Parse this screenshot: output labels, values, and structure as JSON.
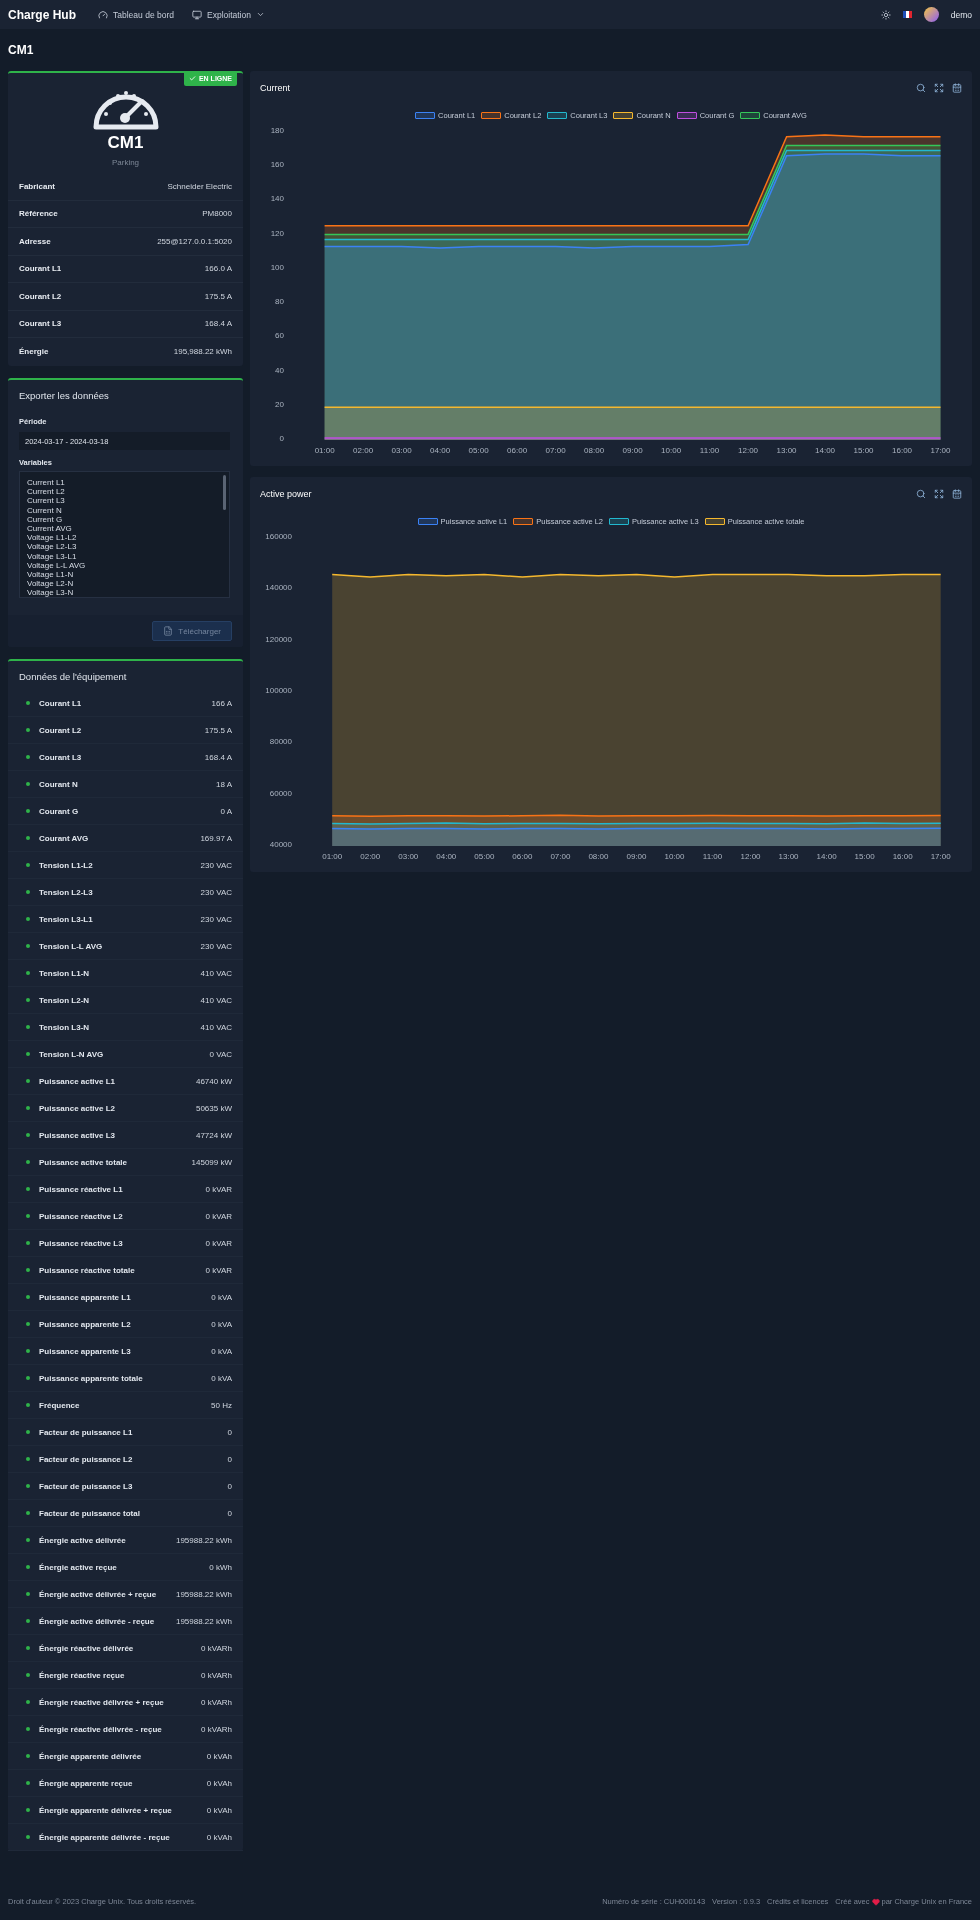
{
  "header": {
    "brand": "Charge Hub",
    "nav": [
      {
        "label": "Tableau de bord",
        "kind": "link"
      },
      {
        "label": "Exploitation",
        "kind": "dropdown"
      }
    ],
    "user": "demo"
  },
  "page_title": "CM1",
  "device": {
    "status": "EN LIGNE",
    "online": true,
    "name": "CM1",
    "location": "Parking",
    "properties": [
      {
        "label": "Fabricant",
        "value": "Schneider Electric"
      },
      {
        "label": "Référence",
        "value": "PM8000"
      },
      {
        "label": "Adresse",
        "value": "255@127.0.0.1:5020"
      },
      {
        "label": "Courant L1",
        "value": "166.0 A"
      },
      {
        "label": "Courant L2",
        "value": "175.5 A"
      },
      {
        "label": "Courant L3",
        "value": "168.4 A"
      },
      {
        "label": "Énergie",
        "value": "195,988.22 kWh"
      }
    ]
  },
  "export": {
    "title": "Exporter les données",
    "period_label": "Période",
    "period": "2024-03-17 - 2024-03-18",
    "variables_label": "Variables",
    "variables": [
      "Current L1",
      "Current L2",
      "Current L3",
      "Current N",
      "Current G",
      "Current AVG",
      "Voltage L1-L2",
      "Voltage L2-L3",
      "Voltage L3-L1",
      "Voltage L-L AVG",
      "Voltage L1-N",
      "Voltage L2-N",
      "Voltage L3-N"
    ],
    "download": "Télécharger",
    "download_disabled": true
  },
  "equipment": {
    "title": "Données de l'équipement",
    "rows": [
      {
        "label": "Courant L1",
        "value": "166 A"
      },
      {
        "label": "Courant L2",
        "value": "175.5 A"
      },
      {
        "label": "Courant L3",
        "value": "168.4 A"
      },
      {
        "label": "Courant N",
        "value": "18 A"
      },
      {
        "label": "Courant G",
        "value": "0 A"
      },
      {
        "label": "Courant AVG",
        "value": "169.97 A"
      },
      {
        "label": "Tension L1-L2",
        "value": "230 VAC"
      },
      {
        "label": "Tension L2-L3",
        "value": "230 VAC"
      },
      {
        "label": "Tension L3-L1",
        "value": "230 VAC"
      },
      {
        "label": "Tension L-L AVG",
        "value": "230 VAC"
      },
      {
        "label": "Tension L1-N",
        "value": "410 VAC"
      },
      {
        "label": "Tension L2-N",
        "value": "410 VAC"
      },
      {
        "label": "Tension L3-N",
        "value": "410 VAC"
      },
      {
        "label": "Tension L-N AVG",
        "value": "0 VAC"
      },
      {
        "label": "Puissance active L1",
        "value": "46740 kW"
      },
      {
        "label": "Puissance active L2",
        "value": "50635 kW"
      },
      {
        "label": "Puissance active L3",
        "value": "47724 kW"
      },
      {
        "label": "Puissance active totale",
        "value": "145099 kW"
      },
      {
        "label": "Puissance réactive L1",
        "value": "0 kVAR"
      },
      {
        "label": "Puissance réactive L2",
        "value": "0 kVAR"
      },
      {
        "label": "Puissance réactive L3",
        "value": "0 kVAR"
      },
      {
        "label": "Puissance réactive totale",
        "value": "0 kVAR"
      },
      {
        "label": "Puissance apparente L1",
        "value": "0 kVA"
      },
      {
        "label": "Puissance apparente L2",
        "value": "0 kVA"
      },
      {
        "label": "Puissance apparente L3",
        "value": "0 kVA"
      },
      {
        "label": "Puissance apparente totale",
        "value": "0 kVA"
      },
      {
        "label": "Fréquence",
        "value": "50 Hz"
      },
      {
        "label": "Facteur de puissance L1",
        "value": "0"
      },
      {
        "label": "Facteur de puissance L2",
        "value": "0"
      },
      {
        "label": "Facteur de puissance L3",
        "value": "0"
      },
      {
        "label": "Facteur de puissance total",
        "value": "0"
      },
      {
        "label": "Énergie active délivrée",
        "value": "195988.22 kWh"
      },
      {
        "label": "Énergie active reçue",
        "value": "0 kWh"
      },
      {
        "label": "Énergie active délivrée + reçue",
        "value": "195988.22 kWh"
      },
      {
        "label": "Énergie active délivrée - reçue",
        "value": "195988.22 kWh"
      },
      {
        "label": "Énergie réactive délivrée",
        "value": "0 kVARh"
      },
      {
        "label": "Énergie réactive reçue",
        "value": "0 kVARh"
      },
      {
        "label": "Énergie réactive délivrée + reçue",
        "value": "0 kVARh"
      },
      {
        "label": "Énergie réactive délivrée - reçue",
        "value": "0 kVARh"
      },
      {
        "label": "Énergie apparente délivrée",
        "value": "0 kVAh"
      },
      {
        "label": "Énergie apparente reçue",
        "value": "0 kVAh"
      },
      {
        "label": "Énergie apparente délivrée + reçue",
        "value": "0 kVAh"
      },
      {
        "label": "Énergie apparente délivrée - reçue",
        "value": "0 kVAh"
      }
    ]
  },
  "charts": [
    {
      "title": "Current",
      "chart_data": {
        "type": "area",
        "legend": "top",
        "categories": [
          "01:00",
          "02:00",
          "03:00",
          "04:00",
          "05:00",
          "06:00",
          "07:00",
          "08:00",
          "09:00",
          "10:00",
          "11:00",
          "12:00",
          "13:00",
          "14:00",
          "15:00",
          "16:00",
          "17:00"
        ],
        "ylim": [
          0,
          180
        ],
        "yticks": [
          0,
          20,
          40,
          60,
          80,
          100,
          120,
          140,
          160,
          180
        ],
        "series": [
          {
            "name": "Courant L1",
            "color": "#3b82f6",
            "values": [
              112,
              112,
              112,
              111,
              112,
              112,
              112,
              111,
              112,
              112,
              112,
              113,
              165,
              166,
              166,
              165,
              165
            ]
          },
          {
            "name": "Courant L2",
            "color": "#f97316",
            "values": [
              124,
              124,
              124,
              124,
              124,
              124,
              124,
              124,
              124,
              124,
              124,
              124,
              176,
              177,
              176,
              176,
              176
            ]
          },
          {
            "name": "Courant L3",
            "color": "#22b8cf",
            "values": [
              116,
              116,
              116,
              116,
              116,
              116,
              116,
              116,
              116,
              116,
              116,
              116,
              168,
              168,
              168,
              168,
              168
            ]
          },
          {
            "name": "Courant N",
            "color": "#f5b82e",
            "values": [
              18,
              18,
              18,
              18,
              18,
              18,
              18,
              18,
              18,
              18,
              18,
              18,
              18,
              18,
              18,
              18,
              18
            ]
          },
          {
            "name": "Courant G",
            "color": "#c04ee0",
            "values": [
              0,
              0,
              0,
              0,
              0,
              0,
              0,
              0,
              0,
              0,
              0,
              0,
              0,
              0,
              0,
              0,
              0
            ]
          },
          {
            "name": "Courant AVG",
            "color": "#34c759",
            "values": [
              119,
              119,
              119,
              119,
              119,
              119,
              119,
              119,
              119,
              119,
              119,
              119,
              171,
              171,
              171,
              171,
              171
            ]
          }
        ]
      }
    },
    {
      "title": "Active power",
      "chart_data": {
        "type": "area",
        "legend": "top",
        "categories": [
          "01:00",
          "02:00",
          "03:00",
          "04:00",
          "05:00",
          "06:00",
          "07:00",
          "08:00",
          "09:00",
          "10:00",
          "11:00",
          "12:00",
          "13:00",
          "14:00",
          "15:00",
          "16:00",
          "17:00"
        ],
        "ylim": [
          40000,
          160000
        ],
        "yticks": [
          40000,
          60000,
          80000,
          100000,
          120000,
          140000,
          160000
        ],
        "series": [
          {
            "name": "Puissance active L1",
            "color": "#3b82f6",
            "values": [
              46000,
              45800,
              46000,
              46000,
              45900,
              46000,
              46000,
              45900,
              46000,
              46000,
              46100,
              46000,
              46000,
              45900,
              46000,
              46000,
              46100
            ]
          },
          {
            "name": "Puissance active L2",
            "color": "#f97316",
            "values": [
              51000,
              50800,
              51000,
              51000,
              50900,
              51000,
              51200,
              50900,
              51000,
              51000,
              51100,
              51000,
              51000,
              50900,
              51000,
              51000,
              51100
            ]
          },
          {
            "name": "Puissance active L3",
            "color": "#22b8cf",
            "values": [
              48000,
              47800,
              48000,
              48200,
              47900,
              48000,
              48000,
              47900,
              48000,
              48000,
              48100,
              48000,
              48000,
              47900,
              48200,
              48000,
              48100
            ]
          },
          {
            "name": "Puissance active totale",
            "color": "#f5b82e",
            "values": [
              145000,
              144000,
              145000,
              144500,
              145000,
              144000,
              145000,
              144500,
              145000,
              144000,
              145000,
              145000,
              145000,
              144500,
              144500,
              145000,
              145000
            ]
          }
        ]
      }
    }
  ],
  "footer": {
    "copyright": "Droit d'auteur © 2023 Charge Unix. Tous droits réservés.",
    "serial": "Numéro de série : CUH000143",
    "version": "Version : 0.9.3",
    "credits": "Crédits et licences",
    "made_with": "Créé avec",
    "made_by": "par Charge Unix en France"
  }
}
